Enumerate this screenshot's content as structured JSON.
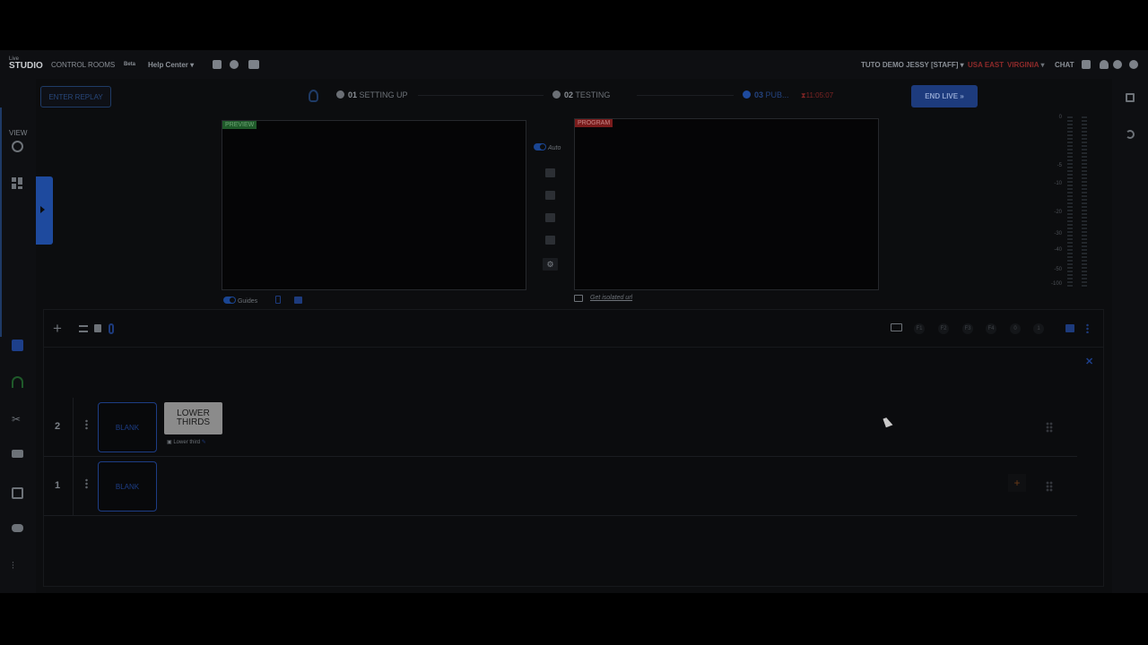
{
  "logo": {
    "line1": "Live",
    "line2": "STUDIO"
  },
  "topbar": {
    "control_rooms": "CONTROL ROOMS",
    "tag": "Beta",
    "help_center": "Help Center",
    "account": "TUTO DEMO JESSY [STAFF]",
    "region": "USA EAST",
    "region_city": "VIRGINIA",
    "chat": "CHAT"
  },
  "rail": {
    "view_label": "VIEW"
  },
  "header": {
    "enter_replay": "ENTER REPLAY",
    "steps": [
      {
        "num": "01",
        "label": "SETTING UP"
      },
      {
        "num": "02",
        "label": "TESTING"
      },
      {
        "num": "03",
        "label": "PUB..."
      }
    ],
    "timer": "11:05:07",
    "end_live": "END LIVE"
  },
  "preview": {
    "tag": "PREVIEW",
    "guides_label": "Guides"
  },
  "program": {
    "tag": "PROGRAM",
    "isolated_url": "Get isolated url"
  },
  "transition": {
    "auto_label": "Auto"
  },
  "vu_labels": [
    "0",
    "-5",
    "-10",
    "-20",
    "-30",
    "-40",
    "-50",
    "-100"
  ],
  "function_keys": [
    "F1",
    "F2",
    "F3",
    "F4",
    "0",
    "1"
  ],
  "layers": [
    {
      "number": "2",
      "blank_label": "BLANK",
      "card_title": "LOWER THIRDS",
      "card_caption": "Lower third"
    },
    {
      "number": "1",
      "blank_label": "BLANK"
    }
  ],
  "colors": {
    "accent": "#1d3b7d",
    "preview": "#1f5a2a",
    "program": "#7a1c1c",
    "warning": "#8e2a2a"
  }
}
